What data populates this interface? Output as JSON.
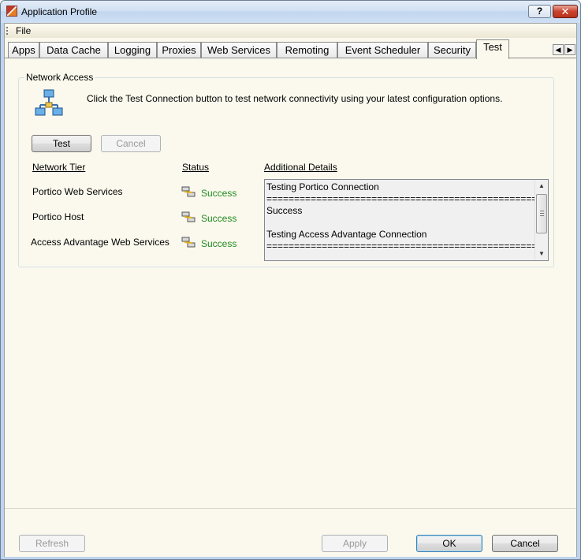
{
  "window": {
    "title": "Application Profile",
    "help_label": "?",
    "close_label": "✕"
  },
  "menu": {
    "file": "File"
  },
  "tabs": [
    {
      "label": "Apps"
    },
    {
      "label": "Data Cache"
    },
    {
      "label": "Logging"
    },
    {
      "label": "Proxies"
    },
    {
      "label": "Web Services"
    },
    {
      "label": "Remoting"
    },
    {
      "label": "Event Scheduler"
    },
    {
      "label": "Security"
    },
    {
      "label": "Test"
    }
  ],
  "active_tab": "Test",
  "tab_scroll": {
    "left": "◀",
    "right": "▶"
  },
  "network_access": {
    "group_title": "Network Access",
    "instructions": "Click the Test Connection button to test network connectivity using your latest configuration options.",
    "test_button": "Test",
    "cancel_button": "Cancel",
    "columns": {
      "tier": "Network Tier",
      "status": "Status",
      "details": "Additional Details"
    },
    "rows": [
      {
        "tier": "Portico Web Services",
        "status": "Success"
      },
      {
        "tier": "Portico Host",
        "status": "Success"
      },
      {
        "tier": "Access Advantage Web Services",
        "status": "Success"
      }
    ],
    "details_text": "Testing Portico Connection\n=====================================================\nSuccess\n\nTesting Access Advantage Connection\n=====================================================",
    "success_color": "#1f8a1f"
  },
  "footer": {
    "refresh": "Refresh",
    "apply": "Apply",
    "ok": "OK",
    "cancel": "Cancel"
  }
}
